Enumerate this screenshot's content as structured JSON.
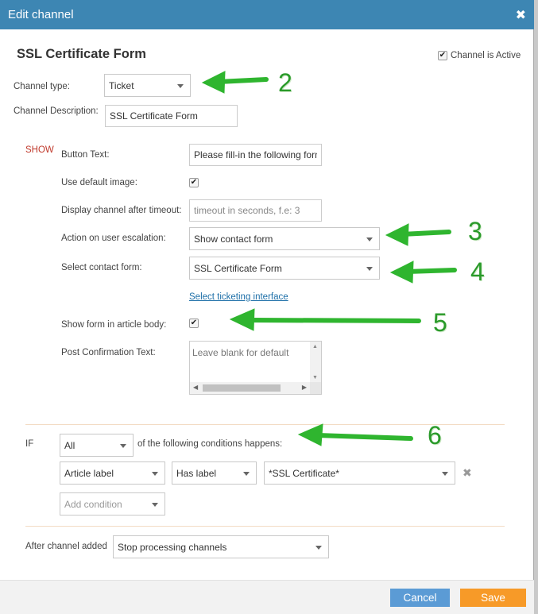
{
  "dialog": {
    "title": "Edit channel",
    "close_glyph": "✖",
    "heading": "SSL Certificate Form",
    "channel_active_label": "Channel is Active"
  },
  "channel": {
    "type_label": "Channel type:",
    "type_value": "Ticket",
    "description_label": "Channel Description:",
    "description_value": "SSL Certificate Form"
  },
  "show": {
    "section_label": "SHOW",
    "button_text_label": "Button Text:",
    "button_text_value": "Please fill-in the following form",
    "use_default_image_label": "Use default image:",
    "display_timeout_label": "Display channel after timeout:",
    "display_timeout_placeholder": "timeout in seconds, f.e: 3",
    "escalation_label": "Action on user escalation:",
    "escalation_value": "Show contact form",
    "contact_form_label": "Select contact form:",
    "contact_form_value": "SSL Certificate Form",
    "ticketing_link": "Select ticketing interface",
    "show_in_article_label": "Show form in article body:",
    "post_confirmation_label": "Post Confirmation Text:",
    "post_confirmation_placeholder": "Leave blank for default"
  },
  "conditions": {
    "if_label": "IF",
    "match_value": "All",
    "match_suffix": "of the following conditions happens:",
    "rows": [
      {
        "field": "Article label",
        "operator": "Has label",
        "value": "*SSL Certificate*"
      }
    ],
    "add_condition_placeholder": "Add condition",
    "remove_glyph": "✖"
  },
  "after": {
    "label": "After channel added",
    "value": "Stop processing channels"
  },
  "footer": {
    "cancel_label": "Cancel",
    "save_label": "Save"
  },
  "annotations": [
    "2",
    "3",
    "4",
    "5",
    "6"
  ],
  "colors": {
    "titlebar": "#3d86b3",
    "cancel": "#5b9bd5",
    "save": "#f79a28",
    "annotation_arrow": "#2fb52f",
    "show_label": "#c0392b",
    "link": "#1d6fa8"
  }
}
